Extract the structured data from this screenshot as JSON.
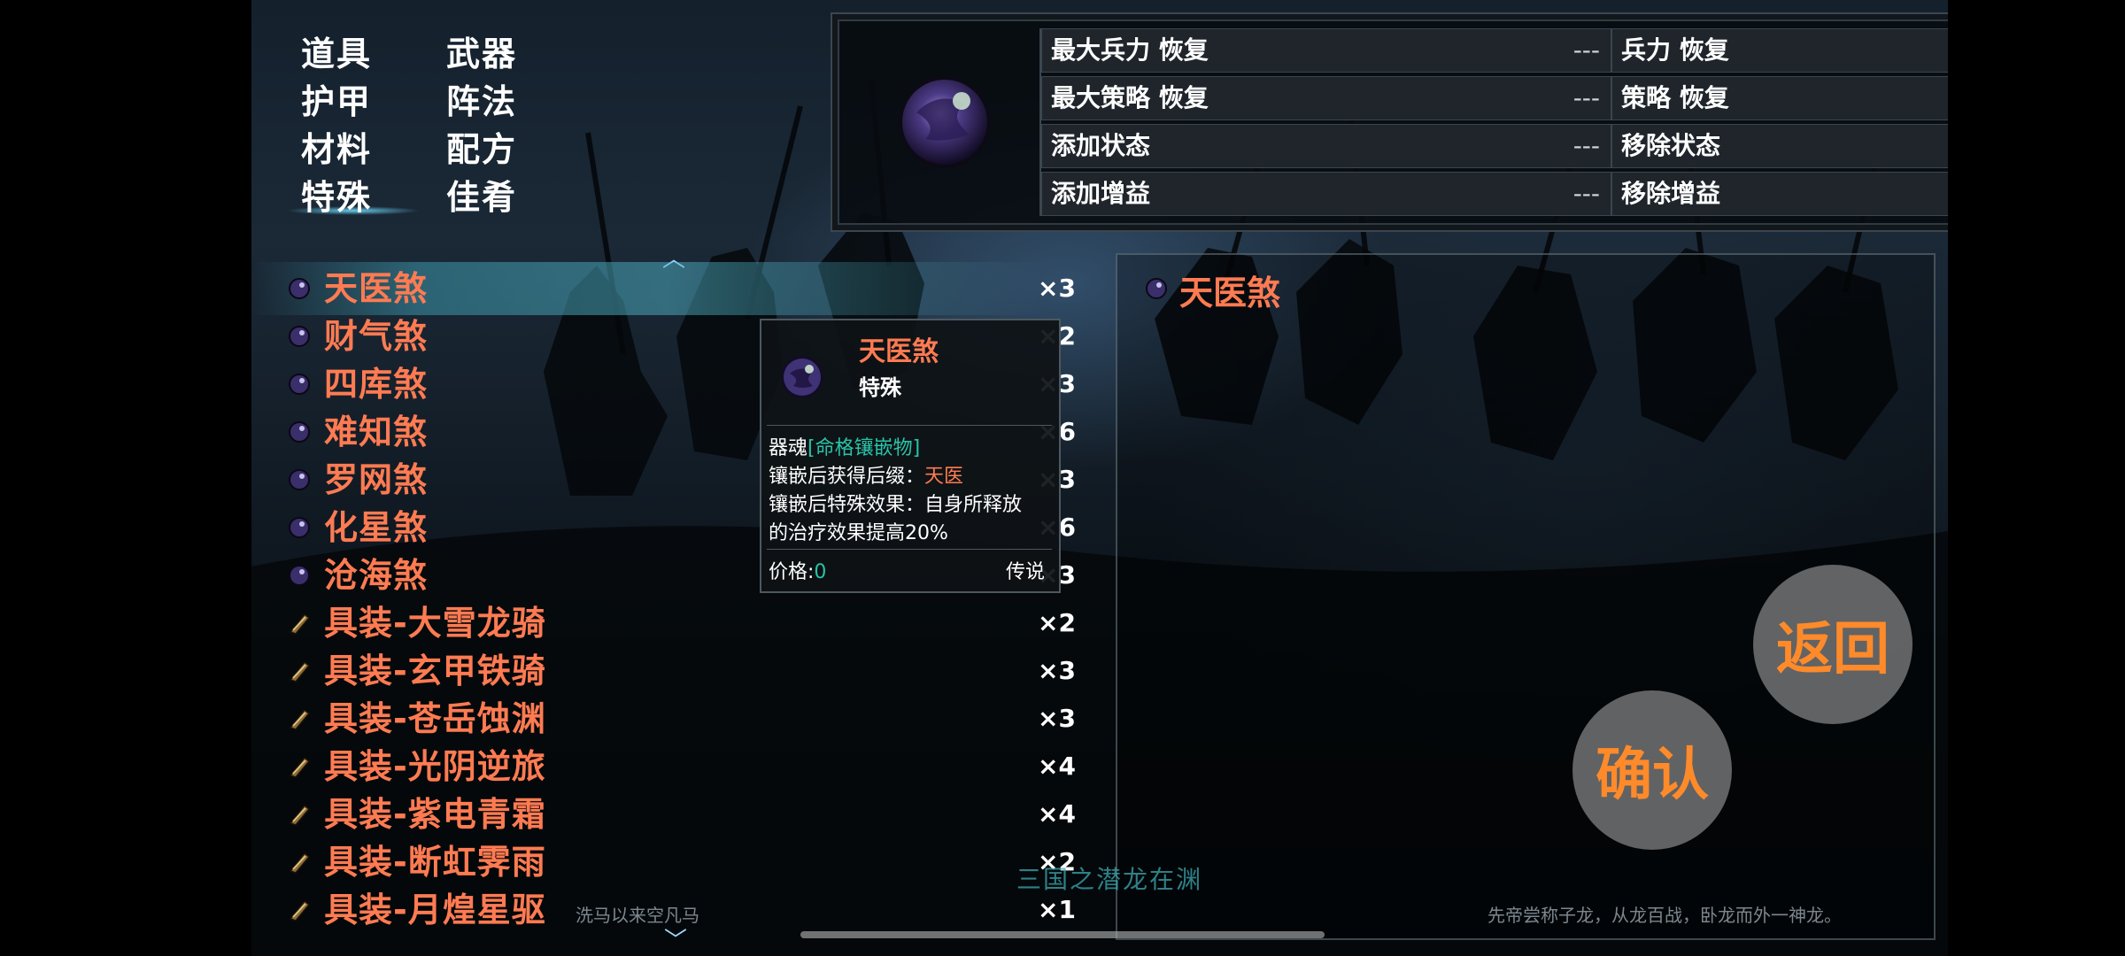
{
  "categories": [
    {
      "label": "道具",
      "active": false
    },
    {
      "label": "武器",
      "active": false
    },
    {
      "label": "护甲",
      "active": false
    },
    {
      "label": "阵法",
      "active": false
    },
    {
      "label": "材料",
      "active": false
    },
    {
      "label": "配方",
      "active": false
    },
    {
      "label": "特殊",
      "active": true
    },
    {
      "label": "佳肴",
      "active": false
    }
  ],
  "stats": [
    {
      "label": "最大兵力 恢复",
      "value": "---"
    },
    {
      "label": "兵力 恢复",
      "value": "---"
    },
    {
      "label": "最大策略 恢复",
      "value": "---"
    },
    {
      "label": "策略 恢复",
      "value": "---"
    },
    {
      "label": "添加状态",
      "value": "---"
    },
    {
      "label": "移除状态",
      "value": "---"
    },
    {
      "label": "添加增益",
      "value": "---"
    },
    {
      "label": "移除增益",
      "value": "---"
    }
  ],
  "items": [
    {
      "name": "天医煞",
      "qty": "×3",
      "icon": "purple-orb-icon",
      "selected": true
    },
    {
      "name": "财气煞",
      "qty": "×2",
      "icon": "purple-orb-icon"
    },
    {
      "name": "四库煞",
      "qty": "×3",
      "icon": "purple-orb-icon"
    },
    {
      "name": "难知煞",
      "qty": "×6",
      "icon": "purple-orb-icon"
    },
    {
      "name": "罗网煞",
      "qty": "×3",
      "icon": "purple-orb-icon"
    },
    {
      "name": "化星煞",
      "qty": "×6",
      "icon": "purple-orb-icon"
    },
    {
      "name": "沧海煞",
      "qty": "×3",
      "icon": "purple-orb-icon"
    },
    {
      "name": "具装-大雪龙骑",
      "qty": "×2",
      "icon": "armor-scroll-icon"
    },
    {
      "name": "具装-玄甲铁骑",
      "qty": "×3",
      "icon": "armor-scroll-icon"
    },
    {
      "name": "具装-苍岳蚀渊",
      "qty": "×3",
      "icon": "armor-scroll-icon"
    },
    {
      "name": "具装-光阴逆旅",
      "qty": "×4",
      "icon": "armor-scroll-icon"
    },
    {
      "name": "具装-紫电青霜",
      "qty": "×4",
      "icon": "armor-scroll-icon"
    },
    {
      "name": "具装-断虹霁雨",
      "qty": "×2",
      "icon": "armor-scroll-icon"
    },
    {
      "name": "具装-月煌星驱",
      "qty": "×1",
      "icon": "armor-scroll-icon"
    }
  ],
  "popup": {
    "title": "天医煞",
    "type": "特殊",
    "line1_prefix": "器魂",
    "line1_tag": "[命格镶嵌物]",
    "line2_prefix": "镶嵌后获得后缀：",
    "line2_value": "天医",
    "line3": "镶嵌后特殊效果：自身所释放",
    "line4": "的治疗效果提高20%",
    "price_label": "价格:",
    "price_value": "0",
    "rarity": "传说"
  },
  "detail": {
    "name": "天医煞"
  },
  "buttons": {
    "back": "返回",
    "confirm": "确认"
  },
  "bottom": {
    "left_text": "洗马以来空凡马",
    "center_title": "三国之潜龙在渊",
    "right_text": "先帝尝称子龙，从龙百战，卧龙而外一神龙。"
  },
  "colors": {
    "item_name": "#ff7b52",
    "accent_teal": "#29c3a8",
    "button_text": "#ff8a2a"
  }
}
